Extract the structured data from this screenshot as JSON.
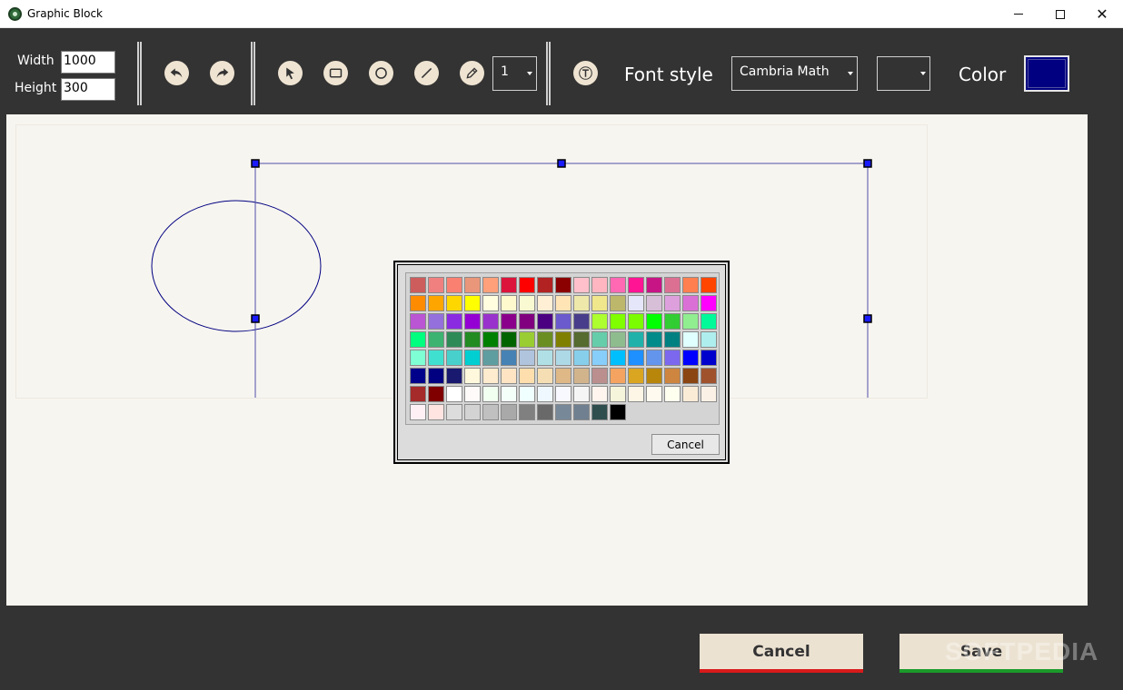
{
  "window": {
    "title": "Graphic Block",
    "minimize": "–",
    "maximize": "☐",
    "close": "✕"
  },
  "toolbar": {
    "width_label": "Width",
    "width_value": "1000",
    "height_label": "Height",
    "height_value": "300",
    "line_width_value": "1",
    "font_style_label": "Font style",
    "font_value": "Cambria Math",
    "font_size_value": "",
    "color_label": "Color",
    "current_color": "#000080",
    "icons": [
      "undo-icon",
      "redo-icon",
      "select-arrow-icon",
      "rectangle-icon",
      "circle-icon",
      "line-icon",
      "pencil-icon",
      "text-icon"
    ]
  },
  "color_picker": {
    "cancel_label": "Cancel",
    "colors": [
      "#CD5C5C",
      "#F08080",
      "#FA8072",
      "#E9967A",
      "#FFA07A",
      "#DC143C",
      "#FF0000",
      "#B22222",
      "#8B0000",
      "#FFC0CB",
      "#FFB6C1",
      "#FF69B4",
      "#FF1493",
      "#C71585",
      "#DB7093",
      "#FF7F50",
      "#FF4500",
      "#FF8C00",
      "#FFA500",
      "#FFD700",
      "#FFFF00",
      "#FFFFE0",
      "#FFFACD",
      "#FAFAD2",
      "#FFEFD5",
      "#FFE4B5",
      "#EEE8AA",
      "#F0E68C",
      "#BDB76B",
      "#E6E6FA",
      "#D8BFD8",
      "#DDA0DD",
      "#DA70D6",
      "#FF00FF",
      "#BA55D3",
      "#9370DB",
      "#8A2BE2",
      "#9400D3",
      "#9932CC",
      "#8B008B",
      "#800080",
      "#4B0082",
      "#6A5ACD",
      "#483D8B",
      "#ADFF2F",
      "#7FFF00",
      "#7CFC00",
      "#00FF00",
      "#32CD32",
      "#90EE90",
      "#00FA9A",
      "#00FF7F",
      "#3CB371",
      "#2E8B57",
      "#228B22",
      "#008000",
      "#006400",
      "#9ACD32",
      "#6B8E23",
      "#808000",
      "#556B2F",
      "#66CDAA",
      "#8FBC8F",
      "#20B2AA",
      "#008B8B",
      "#008080",
      "#E0FFFF",
      "#AFEEEE",
      "#7FFFD4",
      "#40E0D0",
      "#48D1CC",
      "#00CED1",
      "#5F9EA0",
      "#4682B4",
      "#B0C4DE",
      "#B0E0E6",
      "#ADD8E6",
      "#87CEEB",
      "#87CEFA",
      "#00BFFF",
      "#1E90FF",
      "#6495ED",
      "#7B68EE",
      "#0000FF",
      "#0000CD",
      "#00008B",
      "#000080",
      "#191970",
      "#FFF8DC",
      "#FFEBCD",
      "#FFE4C4",
      "#FFDEAD",
      "#F5DEB3",
      "#DEB887",
      "#D2B48C",
      "#BC8F8F",
      "#F4A460",
      "#DAA520",
      "#B8860B",
      "#CD853F",
      "#8B4513",
      "#A0522D",
      "#A52A2A",
      "#800000",
      "#FFFFFF",
      "#FFFAFA",
      "#F0FFF0",
      "#F5FFFA",
      "#F0FFFF",
      "#F0F8FF",
      "#F8F8FF",
      "#F5F5F5",
      "#FFF5EE",
      "#F5F5DC",
      "#FDF5E6",
      "#FFFAF0",
      "#FFFFF0",
      "#FAEBD7",
      "#FAF0E6",
      "#FFF0F5",
      "#FFE4E1",
      "#DCDCDC",
      "#D3D3D3",
      "#C0C0C0",
      "#A9A9A9",
      "#808080",
      "#696969",
      "#778899",
      "#708090",
      "#2F4F4F",
      "#000000"
    ]
  },
  "footer": {
    "cancel_label": "Cancel",
    "save_label": "Save",
    "watermark": "SOFTPEDIA"
  }
}
